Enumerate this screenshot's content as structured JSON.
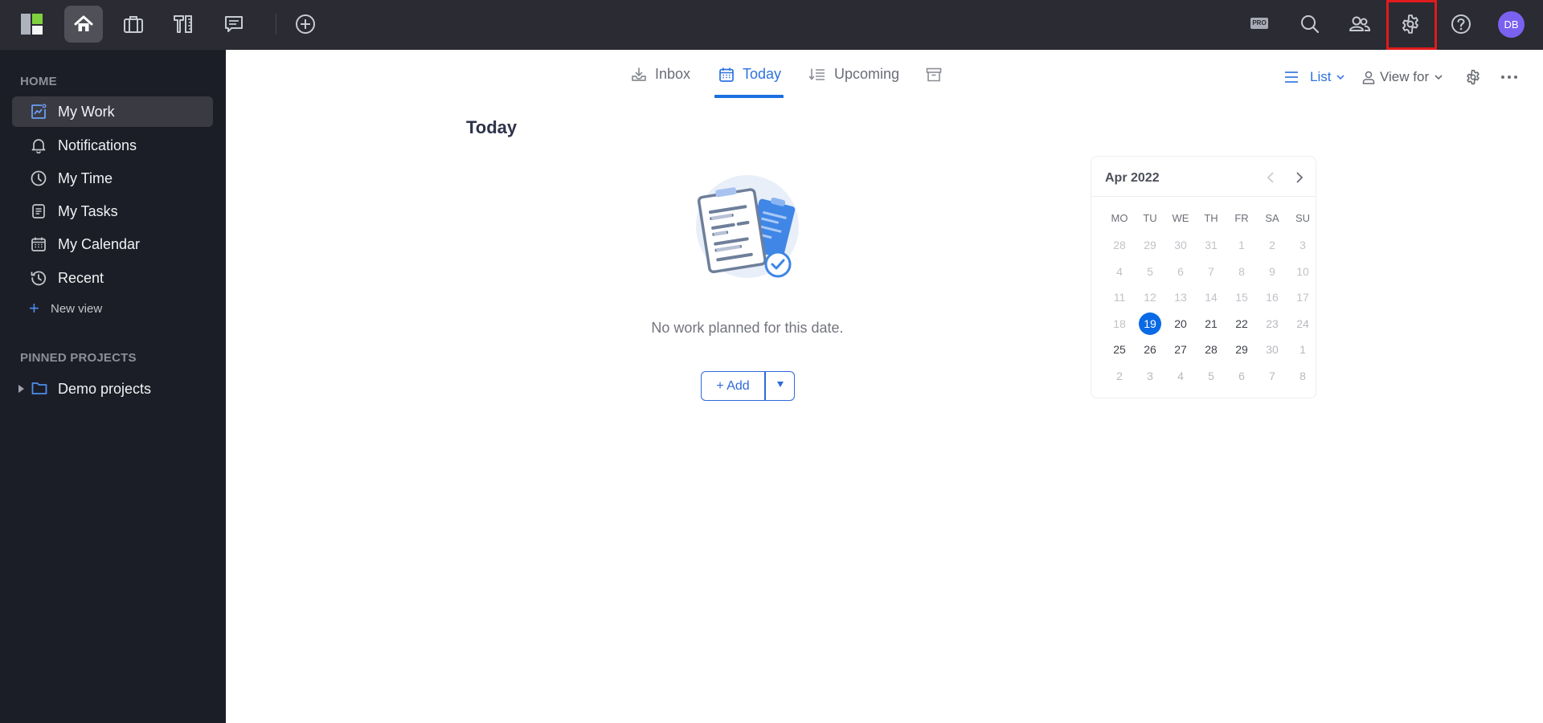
{
  "topbar": {
    "left_icons": [
      {
        "name": "app-logo-icon"
      },
      {
        "name": "home-icon",
        "active": true
      },
      {
        "name": "briefcase-icon"
      },
      {
        "name": "tools-icon"
      },
      {
        "name": "chat-icon"
      },
      {
        "name": "add-circle-icon"
      }
    ],
    "pro_badge": "PRO",
    "right_icons": [
      "search-icon",
      "team-icon",
      "gear-icon",
      "help-icon"
    ],
    "avatar_initials": "DB",
    "avatar_color": "#7b61f0",
    "highlight_color": "#e01b1b"
  },
  "sidebar": {
    "home_section": "HOME",
    "items": [
      {
        "label": "My Work",
        "icon": "chart-icon",
        "active": true
      },
      {
        "label": "Notifications",
        "icon": "bell-icon"
      },
      {
        "label": "My Time",
        "icon": "clock-icon"
      },
      {
        "label": "My Tasks",
        "icon": "document-icon"
      },
      {
        "label": "My Calendar",
        "icon": "calendar-icon"
      },
      {
        "label": "Recent",
        "icon": "history-icon"
      }
    ],
    "new_view_label": "New view",
    "pinned_section": "PINNED PROJECTS",
    "pinned": [
      {
        "label": "Demo projects",
        "icon": "folder-icon"
      }
    ]
  },
  "main": {
    "tabs": [
      {
        "label": "Inbox",
        "icon": "inbox-icon"
      },
      {
        "label": "Today",
        "icon": "calendar-icon",
        "active": true
      },
      {
        "label": "Upcoming",
        "icon": "sort-list-icon"
      },
      {
        "label": "",
        "icon": "archive-icon"
      }
    ],
    "toolbar": {
      "layout_label": "List",
      "view_for_label": "View for"
    },
    "page_title": "Today",
    "empty_message": "No work planned for this date.",
    "add_button_label": "+ Add",
    "accent_color": "#1a6fe0"
  },
  "calendar": {
    "title": "Apr 2022",
    "weekdays": [
      "MO",
      "TU",
      "WE",
      "TH",
      "FR",
      "SA",
      "SU"
    ],
    "selected": "19",
    "weeks": [
      [
        {
          "d": "28",
          "t": "other"
        },
        {
          "d": "29",
          "t": "other"
        },
        {
          "d": "30",
          "t": "other"
        },
        {
          "d": "31",
          "t": "other"
        },
        {
          "d": "1",
          "t": "past"
        },
        {
          "d": "2",
          "t": "past"
        },
        {
          "d": "3",
          "t": "past"
        }
      ],
      [
        {
          "d": "4",
          "t": "past"
        },
        {
          "d": "5",
          "t": "past"
        },
        {
          "d": "6",
          "t": "past"
        },
        {
          "d": "7",
          "t": "past"
        },
        {
          "d": "8",
          "t": "past"
        },
        {
          "d": "9",
          "t": "past"
        },
        {
          "d": "10",
          "t": "past"
        }
      ],
      [
        {
          "d": "11",
          "t": "past"
        },
        {
          "d": "12",
          "t": "past"
        },
        {
          "d": "13",
          "t": "past"
        },
        {
          "d": "14",
          "t": "past"
        },
        {
          "d": "15",
          "t": "past"
        },
        {
          "d": "16",
          "t": "past"
        },
        {
          "d": "17",
          "t": "past"
        }
      ],
      [
        {
          "d": "18",
          "t": "past"
        },
        {
          "d": "19",
          "t": "sel"
        },
        {
          "d": "20",
          "t": "cur"
        },
        {
          "d": "21",
          "t": "cur"
        },
        {
          "d": "22",
          "t": "cur"
        },
        {
          "d": "23",
          "t": "weekend"
        },
        {
          "d": "24",
          "t": "weekend"
        }
      ],
      [
        {
          "d": "25",
          "t": "cur"
        },
        {
          "d": "26",
          "t": "cur"
        },
        {
          "d": "27",
          "t": "cur"
        },
        {
          "d": "28",
          "t": "cur"
        },
        {
          "d": "29",
          "t": "cur"
        },
        {
          "d": "30",
          "t": "weekend"
        },
        {
          "d": "1",
          "t": "weekend"
        }
      ],
      [
        {
          "d": "2",
          "t": "weekend"
        },
        {
          "d": "3",
          "t": "weekend"
        },
        {
          "d": "4",
          "t": "weekend"
        },
        {
          "d": "5",
          "t": "weekend"
        },
        {
          "d": "6",
          "t": "weekend"
        },
        {
          "d": "7",
          "t": "weekend"
        },
        {
          "d": "8",
          "t": "weekend"
        }
      ]
    ]
  }
}
